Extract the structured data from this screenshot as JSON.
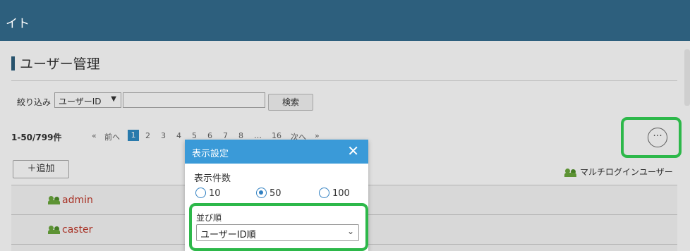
{
  "header": {
    "brand_text": "イト"
  },
  "page": {
    "title": "ユーザー管理"
  },
  "filter": {
    "label": "絞り込み",
    "select_value": "ユーザーID",
    "select_arrow": "▼",
    "search_value": "",
    "search_button": "検索"
  },
  "pagination": {
    "count_text": "1-50/799件",
    "first": "«",
    "prev": "前へ",
    "pages": [
      "1",
      "2",
      "3",
      "4",
      "5",
      "6",
      "7",
      "8"
    ],
    "ellipsis": "…",
    "last_page": "16",
    "next": "次へ",
    "last": "»",
    "active_page": "1"
  },
  "toolbar": {
    "more_label": "···",
    "add_label": "＋追加",
    "multi_login_label": "マルチログインユーザー"
  },
  "users": [
    {
      "name": "admin"
    },
    {
      "name": "caster"
    }
  ],
  "dialog": {
    "title": "表示設定",
    "close": "✕",
    "count_label": "表示件数",
    "count_options": [
      "10",
      "50",
      "100"
    ],
    "selected_count": "50",
    "sort_label": "並び順",
    "sort_value": "ユーザーID順",
    "sort_chevron": "⌄"
  },
  "colors": {
    "header": "#2d5f7d",
    "dialog_header": "#3a9ad8",
    "highlight": "#2db84a",
    "user_name": "#c0392b"
  },
  "icons": {
    "users": "users-icon",
    "more": "ellipsis-icon",
    "close": "close-icon",
    "chevron": "chevron-down-icon"
  }
}
